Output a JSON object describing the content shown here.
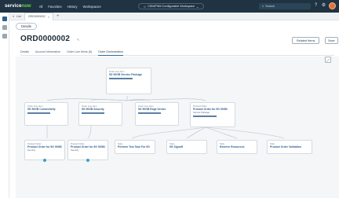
{
  "header": {
    "logo": "servicenow",
    "nav": [
      "All",
      "Favorites",
      "History",
      "Workspaces"
    ],
    "context": "CSM/FSM Configurable Workspace",
    "search_placeholder": "Search",
    "colors": {
      "bar": "#1f3342",
      "accent": "#62d84e",
      "avatar": "#e3733b"
    }
  },
  "tabs": [
    {
      "label": "List"
    },
    {
      "label": "ORD0000002",
      "close": "×"
    }
  ],
  "details_label": "Details",
  "record": {
    "number": "ORD0000002",
    "sub": "",
    "buttons": [
      "Related Items",
      "Save"
    ]
  },
  "record_tabs": [
    "Details",
    "Account Information",
    "Order Line Items (8)",
    "Order Orchestration"
  ],
  "nodes": [
    {
      "label": "Order Line Item",
      "title": "5G 90GB Service Package",
      "sub": "",
      "meta_left": "",
      "meta_right": "",
      "state": ""
    },
    {
      "label": "Order Line Item",
      "title": "5G 90GB Connectivity",
      "sub": "",
      "meta_left": "",
      "meta_right": "",
      "state": ""
    },
    {
      "label": "Order Line Item",
      "title": "5G 90GB Security",
      "sub": "",
      "meta_left": "",
      "meta_right": "",
      "state": ""
    },
    {
      "label": "Order Line Item",
      "title": "5G 90GB Edge Device",
      "sub": "",
      "meta_left": "",
      "meta_right": "",
      "state": ""
    },
    {
      "label": "Product Order",
      "title": "Product Order for 5G 90GB",
      "sub": "Service Package",
      "meta_left": "",
      "meta_right": "",
      "state": ""
    },
    {
      "label": "Product Order",
      "title": "Product Order for 5G 90GB",
      "sub": "Security",
      "meta_left": "",
      "meta_right": "",
      "state": ""
    },
    {
      "label": "Product Order",
      "title": "Product Order for 5G 90GB",
      "sub": "Security",
      "meta_left": "",
      "meta_right": "",
      "state": ""
    },
    {
      "label": "Task",
      "title": "Perform Test Task For 5G",
      "sub": "",
      "meta_left": "",
      "meta_right": "",
      "state": ""
    },
    {
      "label": "Task",
      "title": "5G Signoff",
      "sub": "",
      "meta_left": "",
      "meta_right": "",
      "state": ""
    },
    {
      "label": "Task",
      "title": "Reserve Resources",
      "sub": "",
      "meta_left": "",
      "meta_right": "",
      "state": ""
    },
    {
      "label": "Task",
      "title": "Product Order Validation",
      "sub": "",
      "meta_left": "",
      "meta_right": "",
      "state": ""
    }
  ]
}
